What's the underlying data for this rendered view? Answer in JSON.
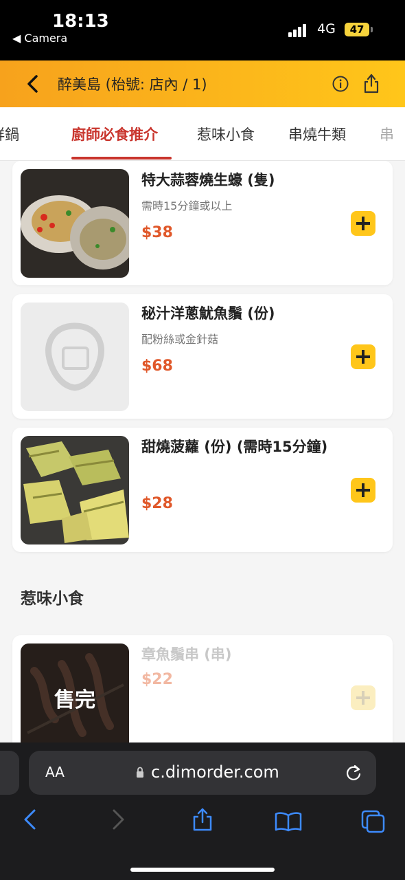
{
  "status_bar": {
    "time": "18:13",
    "back_app": "◀ Camera",
    "network": "4G",
    "battery": "47"
  },
  "header": {
    "title": "醉美島 (枱號: 店內 / 1)"
  },
  "tabs": [
    {
      "label": "鮮鍋"
    },
    {
      "label": "廚師必食推介"
    },
    {
      "label": "惹味小食"
    },
    {
      "label": "串燒牛類"
    },
    {
      "label": "串"
    }
  ],
  "active_tab": "廚師必食推介",
  "items": [
    {
      "name": "特大蒜蓉燒生蠔 (隻)",
      "desc": "需時15分鐘或以上",
      "price": "$38"
    },
    {
      "name": "秘汁洋蔥魷魚鬚 (份)",
      "desc": "配粉絲或金針菇",
      "price": "$68"
    },
    {
      "name": "甜燒菠蘿 (份) (需時15分鐘)",
      "desc": "",
      "price": "$28"
    }
  ],
  "section": {
    "title": "惹味小食",
    "items": [
      {
        "name": "章魚鬚串 (串)",
        "price": "$22",
        "soldout_label": "售完"
      }
    ]
  },
  "browser": {
    "aa": "AA",
    "url": "c.dimorder.com"
  },
  "colors": {
    "header_gradient_start": "#f7a21c",
    "header_gradient_end": "#ffc61a",
    "active_tab": "#c9352d",
    "price": "#e0582a",
    "add_button": "#ffc61a"
  }
}
